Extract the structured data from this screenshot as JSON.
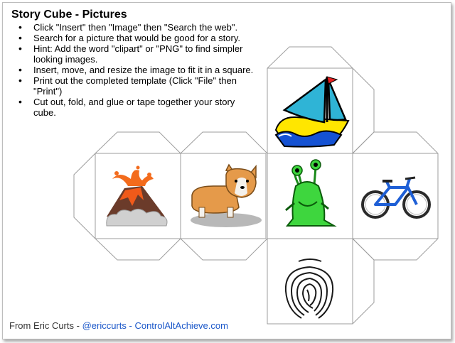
{
  "title": "Story Cube - Pictures",
  "steps": [
    "Click \"Insert\" then \"Image\" then \"Search the web\".",
    "Search for a picture that would be good for a story.",
    "Hint: Add the word \"clipart\" or \"PNG\" to find simpler looking images.",
    "Insert, move, and resize the image to fit it in a square.",
    "Print out the completed template (Click \"File\" then \"Print\")",
    "Cut out, fold, and glue or tape together your story cube."
  ],
  "footer": {
    "author": "From Eric Curts",
    "sep1": " - ",
    "handle": "@ericcurts",
    "sep2": " - ",
    "site": "ControlAltAchieve.com"
  },
  "pictures": [
    "sailboat",
    "volcano",
    "corgi-dog",
    "green-alien",
    "bicycle",
    "fingerprint"
  ],
  "colors": {
    "link": "#1a57c9",
    "net_lines": "#9e9e9e"
  }
}
